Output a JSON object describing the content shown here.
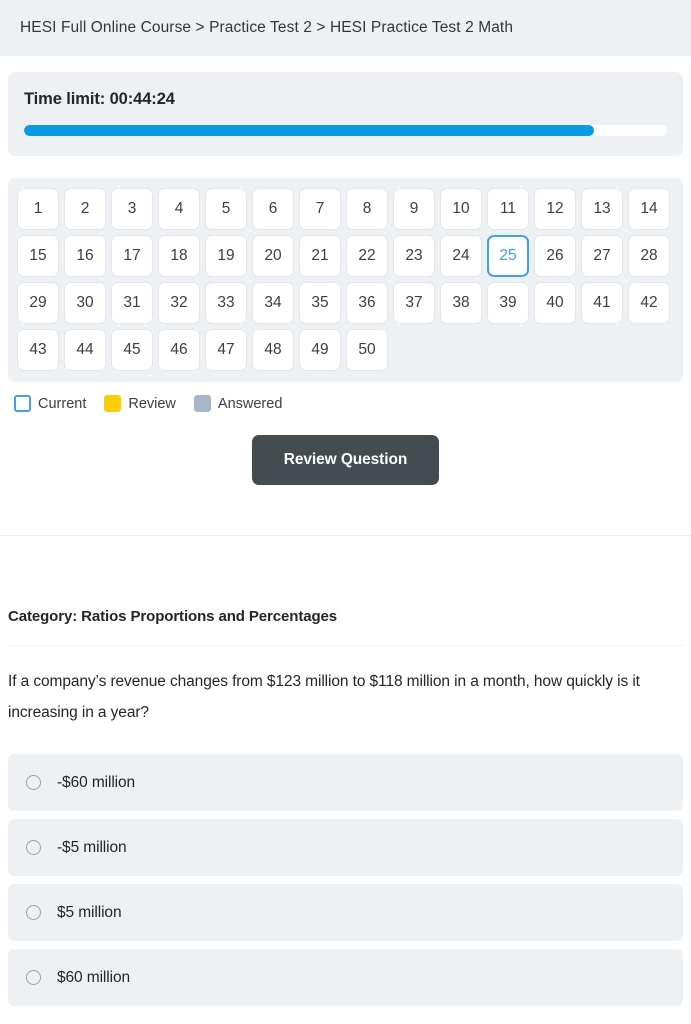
{
  "breadcrumb": {
    "text": "HESI Full Online Course > Practice Test 2 > HESI Practice Test 2 Math",
    "segments": [
      "HESI Full Online Course",
      "Practice Test 2",
      "HESI Practice Test 2 Math"
    ]
  },
  "timer": {
    "label": "Time limit: 00:44:24",
    "time_remaining": "00:44:24",
    "progress_percent": 88.6,
    "fill_color": "#0d9ae5",
    "track_color": "#ffffff"
  },
  "question_grid": {
    "total_questions": 50,
    "columns": 14,
    "current_question": 25,
    "rows": [
      [
        {
          "number": "1",
          "state": "default"
        },
        {
          "number": "2",
          "state": "default"
        },
        {
          "number": "3",
          "state": "default"
        },
        {
          "number": "4",
          "state": "default"
        },
        {
          "number": "5",
          "state": "default"
        },
        {
          "number": "6",
          "state": "default"
        },
        {
          "number": "7",
          "state": "default"
        },
        {
          "number": "8",
          "state": "default"
        },
        {
          "number": "9",
          "state": "default"
        },
        {
          "number": "10",
          "state": "default"
        },
        {
          "number": "11",
          "state": "default"
        },
        {
          "number": "12",
          "state": "default"
        },
        {
          "number": "13",
          "state": "default"
        },
        {
          "number": "14",
          "state": "default"
        }
      ],
      [
        {
          "number": "15",
          "state": "default"
        },
        {
          "number": "16",
          "state": "default"
        },
        {
          "number": "17",
          "state": "default"
        },
        {
          "number": "18",
          "state": "default"
        },
        {
          "number": "19",
          "state": "default"
        },
        {
          "number": "20",
          "state": "default"
        },
        {
          "number": "21",
          "state": "default"
        },
        {
          "number": "22",
          "state": "default"
        },
        {
          "number": "23",
          "state": "default"
        },
        {
          "number": "24",
          "state": "default"
        },
        {
          "number": "25",
          "state": "current"
        },
        {
          "number": "26",
          "state": "default"
        },
        {
          "number": "27",
          "state": "default"
        },
        {
          "number": "28",
          "state": "default"
        }
      ],
      [
        {
          "number": "29",
          "state": "default"
        },
        {
          "number": "30",
          "state": "default"
        },
        {
          "number": "31",
          "state": "default"
        },
        {
          "number": "32",
          "state": "default"
        },
        {
          "number": "33",
          "state": "default"
        },
        {
          "number": "34",
          "state": "default"
        },
        {
          "number": "35",
          "state": "default"
        },
        {
          "number": "36",
          "state": "default"
        },
        {
          "number": "37",
          "state": "default"
        },
        {
          "number": "38",
          "state": "default"
        },
        {
          "number": "39",
          "state": "default"
        },
        {
          "number": "40",
          "state": "default"
        },
        {
          "number": "41",
          "state": "default"
        },
        {
          "number": "42",
          "state": "default"
        }
      ],
      [
        {
          "number": "43",
          "state": "default"
        },
        {
          "number": "44",
          "state": "default"
        },
        {
          "number": "45",
          "state": "default"
        },
        {
          "number": "46",
          "state": "default"
        },
        {
          "number": "47",
          "state": "default"
        },
        {
          "number": "48",
          "state": "default"
        },
        {
          "number": "49",
          "state": "default"
        },
        {
          "number": "50",
          "state": "default"
        }
      ]
    ]
  },
  "legend": {
    "items": [
      {
        "label": "Current",
        "swatch": "current",
        "color": "#ffffff",
        "border_color": "#3fa2e8"
      },
      {
        "label": "Review",
        "swatch": "review",
        "color": "#fbcc09"
      },
      {
        "label": "Answered",
        "swatch": "answered",
        "color": "#a7b6c9"
      }
    ]
  },
  "actions": {
    "review_question_label": "Review Question"
  },
  "question": {
    "category_label": "Category: Ratios Proportions and Percentages",
    "category_name": "Ratios Proportions and Percentages",
    "prompt": "If a company’s revenue changes from $123 million to $118 million in a month, how quickly is it increasing in a year?",
    "selected_option_index": null,
    "options": [
      {
        "label": "-$60 million",
        "selected": false
      },
      {
        "label": "-$5 million",
        "selected": false
      },
      {
        "label": "$5 million",
        "selected": false
      },
      {
        "label": "$60 million",
        "selected": false
      }
    ]
  }
}
